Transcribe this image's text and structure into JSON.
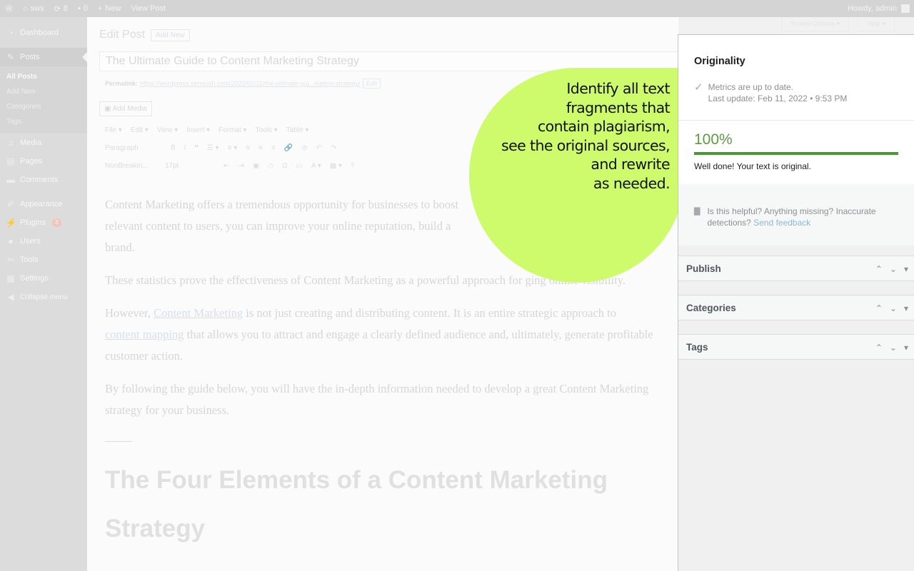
{
  "admin_bar": {
    "site_name": "sws",
    "updates": "8",
    "comments": "0",
    "new": "New",
    "view_post": "View Post",
    "howdy": "Howdy, admin"
  },
  "sidebar": {
    "dashboard": "Dashboard",
    "posts": "Posts",
    "posts_sub": [
      "All Posts",
      "Add New",
      "Categories",
      "Tags"
    ],
    "media": "Media",
    "pages": "Pages",
    "comments": "Comments",
    "appearance": "Appearance",
    "plugins": "Plugins",
    "plugins_badge": "3",
    "users": "Users",
    "tools": "Tools",
    "settings": "Settings",
    "collapse": "Collapse menu"
  },
  "screen_options": {
    "screen": "Screen Options ▾",
    "help": "Help ▾"
  },
  "editor": {
    "page_title": "Edit Post",
    "add_new": "Add New",
    "post_title": "The Ultimate Guide to Content Marketing Strategy",
    "permalink_label": "Permalink:",
    "permalink_url": "https://wordpress.semrush.com/2022/02/11/the-ultimate-gui...rketing-strategy/",
    "permalink_edit": "Edit",
    "add_media": "Add Media",
    "menu": [
      "File ▾",
      "Edit ▾",
      "View ▾",
      "Insert ▾",
      "Format ▾",
      "Tools ▾",
      "Table ▾"
    ],
    "paragraph_select": "Paragraph",
    "font_select": "NonBreakin...",
    "size_select": "17pt",
    "p1": "Content Marketing offers a tremendous opportunity for businesses to boost",
    "p1b": "relevant content to users, you can improve your online reputation, build a",
    "p1c": "brand.",
    "p2a": "These statistics prove the effectiveness of Content Marketing as a powerful approach for g",
    "p2b": "ing online visibility.",
    "p3a": "However, ",
    "p3_link": "Content Marketing",
    "p3b": " is not just creating and distributing content. It is an entire strategic approach to",
    "p3_link2": "content mapping",
    "p3c": " that allows you to attract and engage a clearly defined audience and, ultimately, generate profitable",
    "p3d": "customer action.",
    "p4a": "By following the guide below, you will have the in-depth information needed to develop a great Content Marketing",
    "p4b": "strategy for your business.",
    "heading": "The Four Elements of a Content Marketing Strategy"
  },
  "originality": {
    "title": "Originality",
    "metrics_status": "Metrics are up to date.",
    "last_update": "Last update: Feb 11, 2022 • 9:53 PM",
    "score": "100%",
    "score_fraction": 1.0,
    "score_message": "Well done! Your text is original.",
    "feedback_text": "Is this helpful? Anything missing? Inaccurate detections?",
    "feedback_link": "Send feedback"
  },
  "boxes": {
    "publish": "Publish",
    "categories": "Categories",
    "tags": "Tags"
  },
  "callout": {
    "lines": [
      "Identify all text",
      "fragments that",
      "contain plagiarism,",
      "see the original sources,",
      "and rewrite",
      "as needed."
    ]
  },
  "colors": {
    "callout_bg": "#cdfb6c",
    "score_green": "#4a9a33",
    "link_blue": "#2271b1"
  }
}
